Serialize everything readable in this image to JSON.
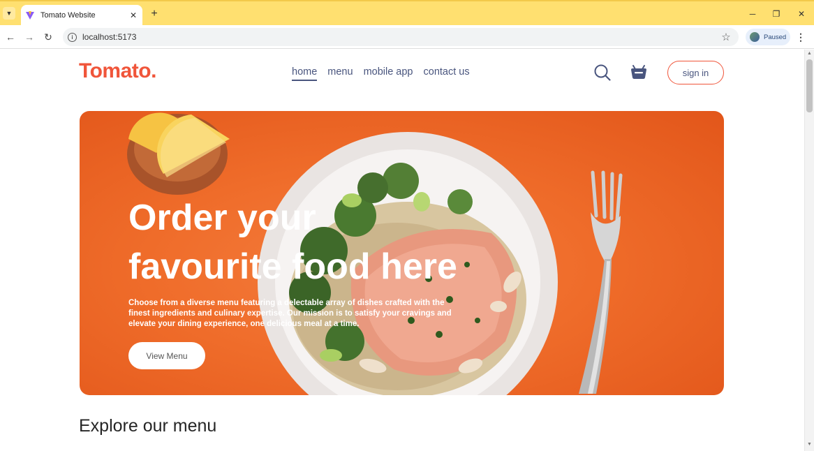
{
  "browser": {
    "tab_title": "Tomato Website",
    "url": "localhost:5173",
    "profile_status": "Paused",
    "colors": {
      "tab_bar": "#ffe070",
      "omnibox": "#f1f3f4"
    }
  },
  "navbar": {
    "logo": "Tomato.",
    "menu": [
      {
        "label": "home",
        "active": true
      },
      {
        "label": "menu",
        "active": false
      },
      {
        "label": "mobile app",
        "active": false
      },
      {
        "label": "contact us",
        "active": false
      }
    ],
    "sign_in_label": "sign in",
    "icons": [
      "search-icon",
      "basket-icon"
    ]
  },
  "hero": {
    "title_line1": "Order your",
    "title_line2": "favourite food here",
    "description": "Choose from a diverse menu featuring a delectable array of dishes crafted with the finest ingredients and culinary expertise. Our mission is to satisfy your cravings and elevate your dining experience, one delicious meal at a time.",
    "button_label": "View Menu"
  },
  "explore": {
    "title": "Explore our menu"
  },
  "colors": {
    "brand": "#f0553a",
    "nav_text": "#49557e",
    "hero_orange": "#ef6c2a"
  }
}
